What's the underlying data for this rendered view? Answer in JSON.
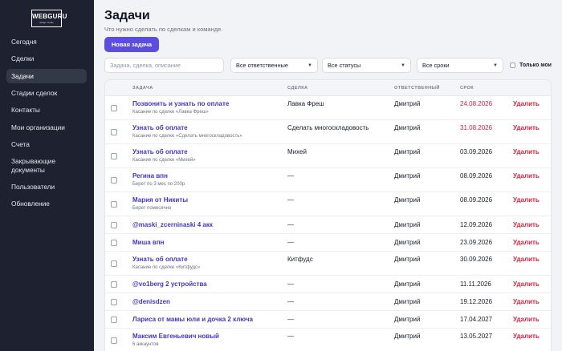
{
  "logo": {
    "main": "WEBGURU",
    "sub": "design studio"
  },
  "sidebar": {
    "items": [
      {
        "label": "Сегодня",
        "active": false,
        "double": false
      },
      {
        "label": "Сделки",
        "active": false,
        "double": false
      },
      {
        "label": "Задачи",
        "active": true,
        "double": false
      },
      {
        "label": "Стадии сделок",
        "active": false,
        "double": false
      },
      {
        "label": "Контакты",
        "active": false,
        "double": false
      },
      {
        "label": "Мои организации",
        "active": false,
        "double": false
      },
      {
        "label": "Счета",
        "active": false,
        "double": false
      },
      {
        "label": "Закрывающие документы",
        "active": false,
        "double": true
      },
      {
        "label": "Пользователи",
        "active": false,
        "double": false
      },
      {
        "label": "Обновление",
        "active": false,
        "double": false
      }
    ]
  },
  "header": {
    "title": "Задачи",
    "subtitle": "Что нужно сделать по сделкам и команде.",
    "new_task_label": "Новая задача"
  },
  "filters": {
    "search_placeholder": "Задача, сделка, описание",
    "owner": "Все ответственные",
    "status": "Все статусы",
    "due": "Все сроки",
    "only_mine": "Только мои"
  },
  "table": {
    "columns": {
      "task": "ЗАДАЧА",
      "deal": "СДЕЛКА",
      "owner": "ОТВЕТСТВЕННЫЙ",
      "due": "СРОК"
    },
    "delete_label": "Удалить",
    "rows": [
      {
        "task": "Позвонить и узнать по оплате",
        "note": "Касание по сделке «Лавка Фреш»",
        "deal": "Лавка Фреш",
        "owner": "Дмитрий",
        "due": "24.08.2026",
        "overdue": true
      },
      {
        "task": "Узнать об оплате",
        "note": "Касание по сделке «Сделать многоскладовость»",
        "deal": "Сделать многоскладовость",
        "owner": "Дмитрий",
        "due": "31.08.2026",
        "overdue": true
      },
      {
        "task": "Узнать об оплате",
        "note": "Касание по сделке «Михей»",
        "deal": "Михей",
        "owner": "Дмитрий",
        "due": "03.09.2026",
        "overdue": false
      },
      {
        "task": "Регина впн",
        "note": "Берет по 3 мес по 200р",
        "deal": "—",
        "owner": "Дмитрий",
        "due": "08.09.2026",
        "overdue": false
      },
      {
        "task": "Мария от Никиты",
        "note": "Берет помесячно",
        "deal": "—",
        "owner": "Дмитрий",
        "due": "08.09.2026",
        "overdue": false
      },
      {
        "task": "@maski_zcerninaski 4 акк",
        "note": "",
        "deal": "—",
        "owner": "Дмитрий",
        "due": "12.09.2026",
        "overdue": false
      },
      {
        "task": "Миша впн",
        "note": "",
        "deal": "—",
        "owner": "Дмитрий",
        "due": "23.09.2026",
        "overdue": false
      },
      {
        "task": "Узнать об оплате",
        "note": "Касание по сделке «Китфудс»",
        "deal": "Китфудс",
        "owner": "Дмитрий",
        "due": "30.09.2026",
        "overdue": false
      },
      {
        "task": "@vo1berg 2 устройства",
        "note": "",
        "deal": "—",
        "owner": "Дмитрий",
        "due": "11.11.2026",
        "overdue": false
      },
      {
        "task": "@denisdzen",
        "note": "",
        "deal": "—",
        "owner": "Дмитрий",
        "due": "19.12.2026",
        "overdue": false
      },
      {
        "task": "Лариса от мамы юли и дочка 2 ключа",
        "note": "",
        "deal": "—",
        "owner": "Дмитрий",
        "due": "17.04.2027",
        "overdue": false
      },
      {
        "task": "Максим Евгеньевич новый",
        "note": "6 аккаунтов",
        "deal": "—",
        "owner": "Дмитрий",
        "due": "13.05.2027",
        "overdue": false
      }
    ]
  },
  "colors": {
    "sidebar_bg": "#1d2130",
    "accent": "#5c4cdf",
    "link": "#4237c5",
    "danger": "#d6233e"
  }
}
